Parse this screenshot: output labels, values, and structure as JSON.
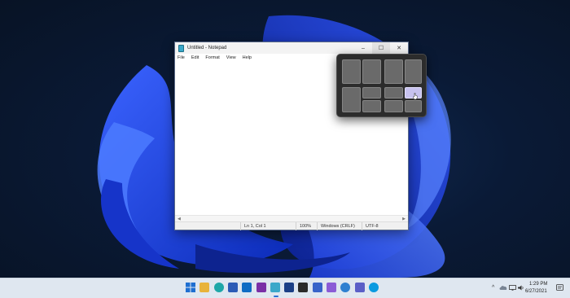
{
  "notepad": {
    "title": "Untitled - Notepad",
    "controls": {
      "minimize": "–",
      "maximize": "☐",
      "close": "✕"
    },
    "menu": [
      "File",
      "Edit",
      "Format",
      "View",
      "Help"
    ],
    "statusbar": {
      "position": "Ln 1, Col 1",
      "zoom": "100%",
      "line_ending": "Windows (CRLF)",
      "encoding": "UTF-8"
    }
  },
  "snap_layouts": {
    "selected_layout": "quadrants",
    "selected_zone": "top-right",
    "accent_color": "#c7c2ef"
  },
  "taskbar": {
    "apps": [
      {
        "name": "start-icon",
        "color": "#1f6fd1"
      },
      {
        "name": "file-explorer-icon",
        "color": "#e8b33b"
      },
      {
        "name": "edge-icon",
        "color": "#1ea7a8"
      },
      {
        "name": "word-icon",
        "color": "#2b5bb6"
      },
      {
        "name": "outlook-icon",
        "color": "#0f6cc4"
      },
      {
        "name": "onenote-icon",
        "color": "#7a2fa6"
      },
      {
        "name": "notepad-icon",
        "color": "#3aa8c9"
      },
      {
        "name": "mp-app-icon",
        "color": "#1b3f86"
      },
      {
        "name": "equalizer-app-icon",
        "color": "#2a2a2a"
      },
      {
        "name": "store-icon",
        "color": "#3763c9"
      },
      {
        "name": "visual-studio-icon",
        "color": "#8b5bd6"
      },
      {
        "name": "globe-app-icon",
        "color": "#2e7fd0"
      },
      {
        "name": "teams-icon",
        "color": "#5b5fc7"
      },
      {
        "name": "skype-icon",
        "color": "#0a9ae0"
      }
    ],
    "tray": {
      "chevron": "^",
      "time": "1:29 PM",
      "date": "6/27/2021"
    }
  }
}
